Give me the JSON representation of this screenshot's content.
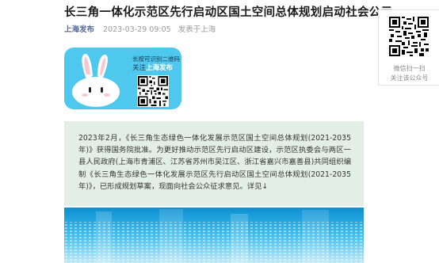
{
  "article": {
    "title": "长三角一体化示范区先行启动区国土空间总体规划启动社会公示",
    "account": "上海发布",
    "time": "2023-03-29 09:05",
    "location": "发表于上海"
  },
  "banner": {
    "qr_label": "长按可识别二维码",
    "follow_prefix": "关注",
    "follow_name": "上海发布",
    "bg_color": "#4fc8ee"
  },
  "side_qr": {
    "scan_label": "微信扫一扫",
    "follow_label": "关注该公众号"
  },
  "intro": {
    "text": "2023年2月，《长三角生态绿色一体化发展示范区国土空间总体规划(2021-2035年)》获得国务院批准。为更好推动示范区先行启动区建设，示范区执委会与两区一县人民政府(上海市青浦区、江苏省苏州市吴江区、浙江省嘉兴市嘉善县)共同组织编制《长三角生态绿色一体化发展示范区先行启动区国土空间总体规划(2021-2035年)》，已形成规划草案，现面向社会公众征求意见。详见↓",
    "bg_color": "#e3efe6"
  },
  "colors": {
    "account": "#576b95",
    "photo_top": "#0d8fd0",
    "photo_mid": "#3cc0f0"
  }
}
